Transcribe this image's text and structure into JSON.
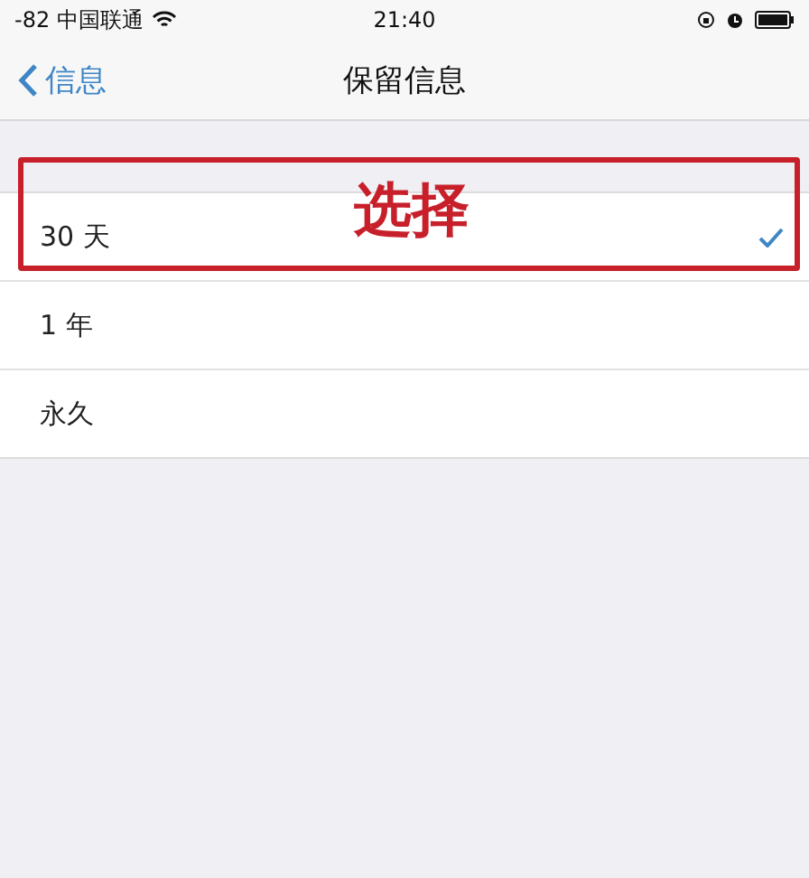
{
  "status_bar": {
    "carrier": "-82 中国联通",
    "time": "21:40"
  },
  "nav_bar": {
    "back": "信息",
    "title": "保留信息"
  },
  "options": [
    {
      "label": "30 天",
      "selected": true
    },
    {
      "label": "1 年",
      "selected": false
    },
    {
      "label": "永久",
      "selected": false
    }
  ],
  "annotation": {
    "label": "选择"
  }
}
